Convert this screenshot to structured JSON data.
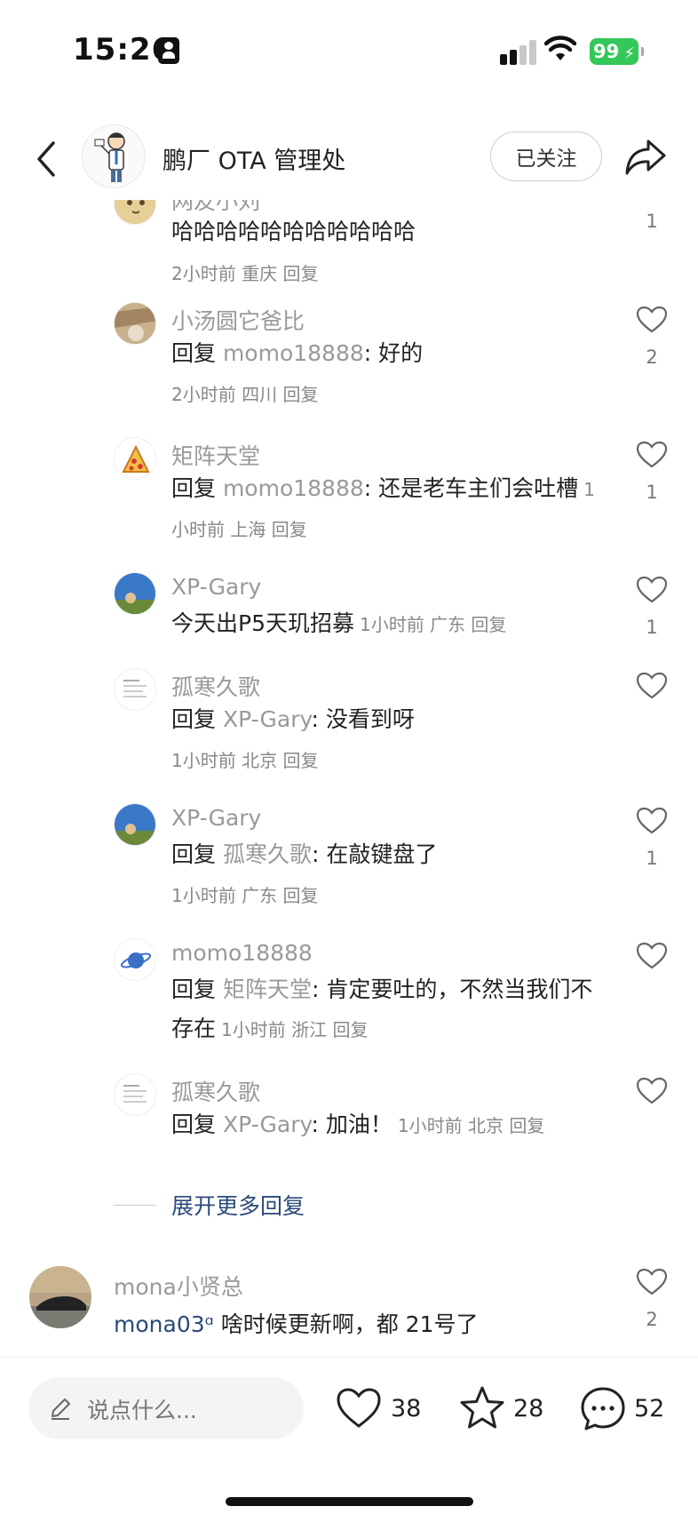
{
  "status_bar": {
    "time": "15:26",
    "battery": "99"
  },
  "nav": {
    "title": "鹏厂 OTA 管理处",
    "follow_label": "已关注"
  },
  "replies": [
    {
      "name": "网友小刘",
      "text": "哈哈哈哈哈哈哈哈哈哈哈",
      "meta": "2小时前 重庆 回复",
      "likes": "1"
    },
    {
      "name": "小汤圆它爸比",
      "prefix": "回复 ",
      "to": "momo18888",
      "text": ": 好的",
      "meta": "2小时前 四川 回复",
      "likes": "2"
    },
    {
      "name": "矩阵天堂",
      "prefix": "回复 ",
      "to": "momo18888",
      "text": ": 还是老车主们会吐槽",
      "meta": "1小时前 上海 回复",
      "likes": "1"
    },
    {
      "name": "XP-Gary",
      "text": "今天出P5天玑招募",
      "meta": "1小时前 广东 回复",
      "likes": "1"
    },
    {
      "name": "孤寒久歌",
      "prefix": "回复 ",
      "to": "XP-Gary",
      "text": ": 没看到呀",
      "meta": "1小时前 北京 回复",
      "likes": ""
    },
    {
      "name": "XP-Gary",
      "prefix": "回复 ",
      "to": "孤寒久歌",
      "text": ": 在敲键盘了",
      "meta": "1小时前 广东 回复",
      "likes": "1"
    },
    {
      "name": "momo18888",
      "prefix": "回复 ",
      "to": "矩阵天堂",
      "text": ": 肯定要吐的，不然当我们不存在",
      "meta": "1小时前 浙江 回复",
      "likes": ""
    },
    {
      "name": "孤寒久歌",
      "prefix": "回复 ",
      "to": "XP-Gary",
      "text": ": 加油！",
      "meta": "1小时前 北京 回复",
      "likes": ""
    }
  ],
  "expand_more": "展开更多回复",
  "main_comment": {
    "name": "mona小贤总",
    "mention": "mona03ᵅ",
    "text": " 啥时候更新啊，都 21号了",
    "likes": "2"
  },
  "bottom_bar": {
    "input_placeholder": "说点什么...",
    "like_count": "38",
    "star_count": "28",
    "comment_count": "52"
  },
  "colors": {
    "accent_link": "#2a4a7a",
    "battery": "#34c759",
    "muted": "#999999"
  }
}
